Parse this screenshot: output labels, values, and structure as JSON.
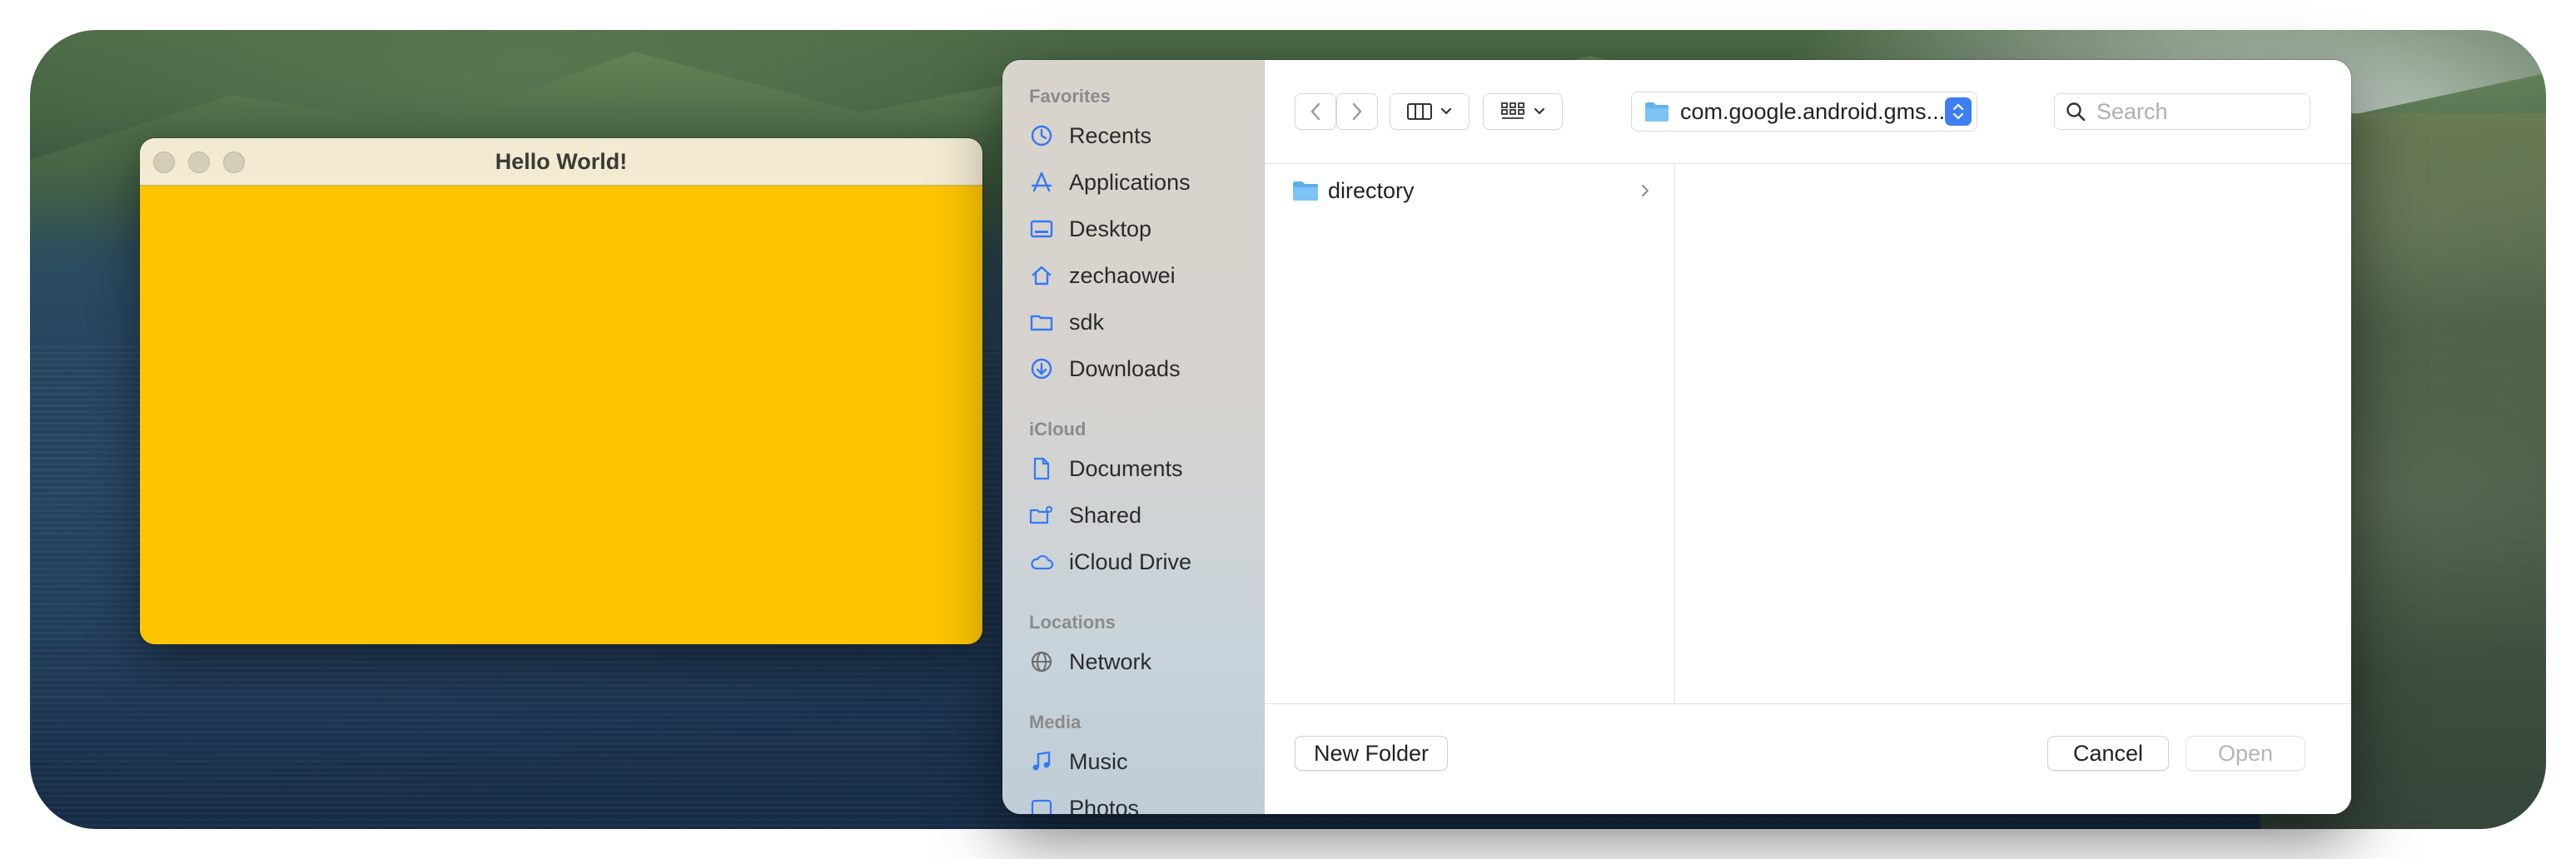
{
  "hello_window": {
    "title": "Hello World!",
    "content_color": "#fdc500"
  },
  "dialog": {
    "sidebar": {
      "sections": [
        {
          "label": "Favorites",
          "items": [
            {
              "label": "Recents",
              "icon": "clock-icon"
            },
            {
              "label": "Applications",
              "icon": "applications-icon"
            },
            {
              "label": "Desktop",
              "icon": "desktop-icon"
            },
            {
              "label": "zechaowei",
              "icon": "home-icon"
            },
            {
              "label": "sdk",
              "icon": "folder-icon"
            },
            {
              "label": "Downloads",
              "icon": "download-icon"
            }
          ]
        },
        {
          "label": "iCloud",
          "items": [
            {
              "label": "Documents",
              "icon": "document-icon"
            },
            {
              "label": "Shared",
              "icon": "shared-folder-icon"
            },
            {
              "label": "iCloud Drive",
              "icon": "cloud-icon"
            }
          ]
        },
        {
          "label": "Locations",
          "items": [
            {
              "label": "Network",
              "icon": "globe-icon"
            }
          ]
        },
        {
          "label": "Media",
          "items": [
            {
              "label": "Music",
              "icon": "music-note-icon"
            },
            {
              "label": "Photos",
              "icon": "photos-icon"
            }
          ]
        }
      ]
    },
    "toolbar": {
      "path": "com.google.android.gms...",
      "search_placeholder": "Search"
    },
    "browser": {
      "column1": [
        {
          "label": "directory",
          "icon": "folder-icon"
        }
      ]
    },
    "footer": {
      "new_folder": "New Folder",
      "cancel": "Cancel",
      "open": "Open"
    },
    "accent_color": "#3d7ef0",
    "icon_color": "#3478f6"
  }
}
